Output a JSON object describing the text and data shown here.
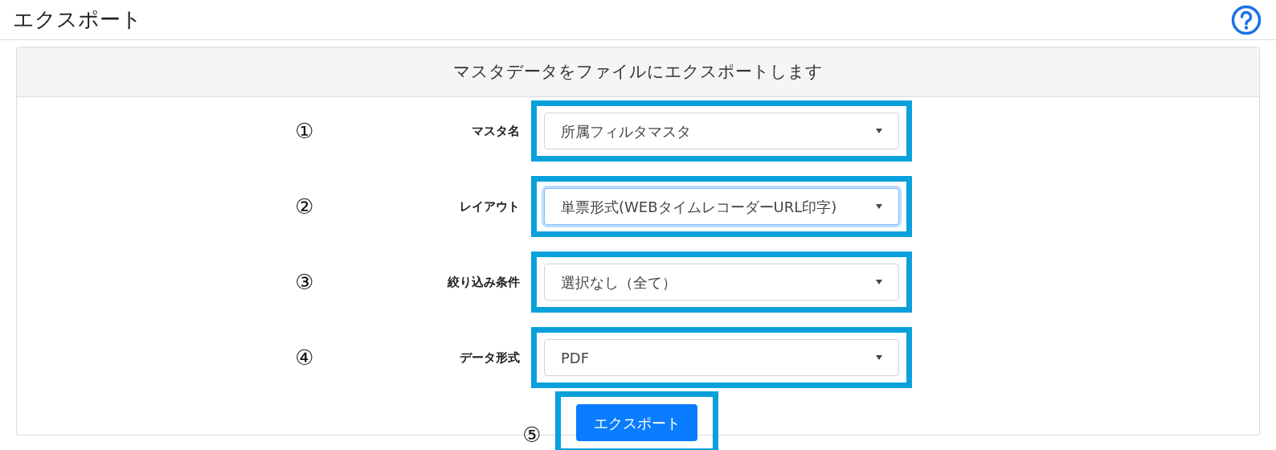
{
  "page_title": "エクスポート",
  "panel": {
    "heading": "マスタデータをファイルにエクスポートします",
    "fields": [
      {
        "number": "①",
        "label": "マスタ名",
        "value": "所属フィルタマスタ",
        "focused": false
      },
      {
        "number": "②",
        "label": "レイアウト",
        "value": "単票形式(WEBタイムレコーダーURL印字)",
        "focused": true
      },
      {
        "number": "③",
        "label": "絞り込み条件",
        "value": "選択なし（全て）",
        "focused": false
      },
      {
        "number": "④",
        "label": "データ形式",
        "value": "PDF",
        "focused": false
      }
    ],
    "action": {
      "number": "⑤",
      "label": "エクスポート"
    }
  }
}
